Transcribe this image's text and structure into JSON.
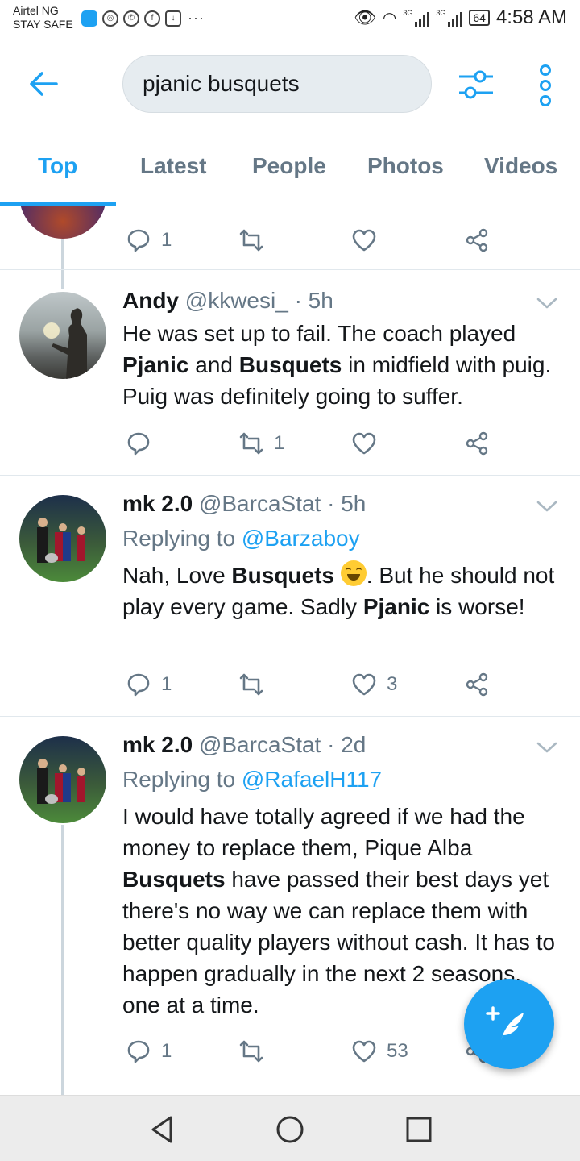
{
  "status_bar": {
    "carrier": "Airtel NG",
    "sub": "STAY SAFE",
    "network1": "3G",
    "network2": "3G",
    "battery": "64",
    "time": "4:58 AM"
  },
  "search": {
    "query": "pjanic busquets"
  },
  "tabs": [
    {
      "label": "Top"
    },
    {
      "label": "Latest"
    },
    {
      "label": "People"
    },
    {
      "label": "Photos"
    },
    {
      "label": "Videos"
    }
  ],
  "partial_tweet": {
    "reply_count": "1"
  },
  "tweets": [
    {
      "name": "Andy",
      "handle": "@kkwesi_ · 5h",
      "text_html": "He was set up to fail. The coach played <b>Pjanic</b> and <b>Busquets</b> in midfield with puig. Puig was definitely going to suffer.",
      "reply_count": "",
      "retweet_count": "1",
      "like_count": ""
    },
    {
      "name": "mk 2.0",
      "handle": "@BarcaStat · 5h",
      "replying_label": "Replying to",
      "replying_to": "@Barzaboy",
      "text_part1": "Nah, Love ",
      "text_bold1": "Busquets",
      "text_part2": ". But he should not play every game. Sadly ",
      "text_bold2": "Pjanic",
      "text_part3": " is worse!",
      "reply_count": "1",
      "retweet_count": "",
      "like_count": "3"
    },
    {
      "name": "mk 2.0",
      "handle": "@BarcaStat · 2d",
      "replying_label": "Replying to",
      "replying_to": "@RafaelH117",
      "text_part1": "I would have totally agreed if we had the money to replace them, Pique Alba ",
      "text_bold1": "Busquets",
      "text_part2": " have passed their best days yet there's no way we can replace them with better quality players without cash. It has to happen gradually in the next 2 seasons, one at a time.",
      "reply_count": "1",
      "retweet_count": "",
      "like_count": "53"
    }
  ],
  "colors": {
    "accent": "#1da1f2",
    "secondary_text": "#657786",
    "divider": "#e1e8ed"
  }
}
